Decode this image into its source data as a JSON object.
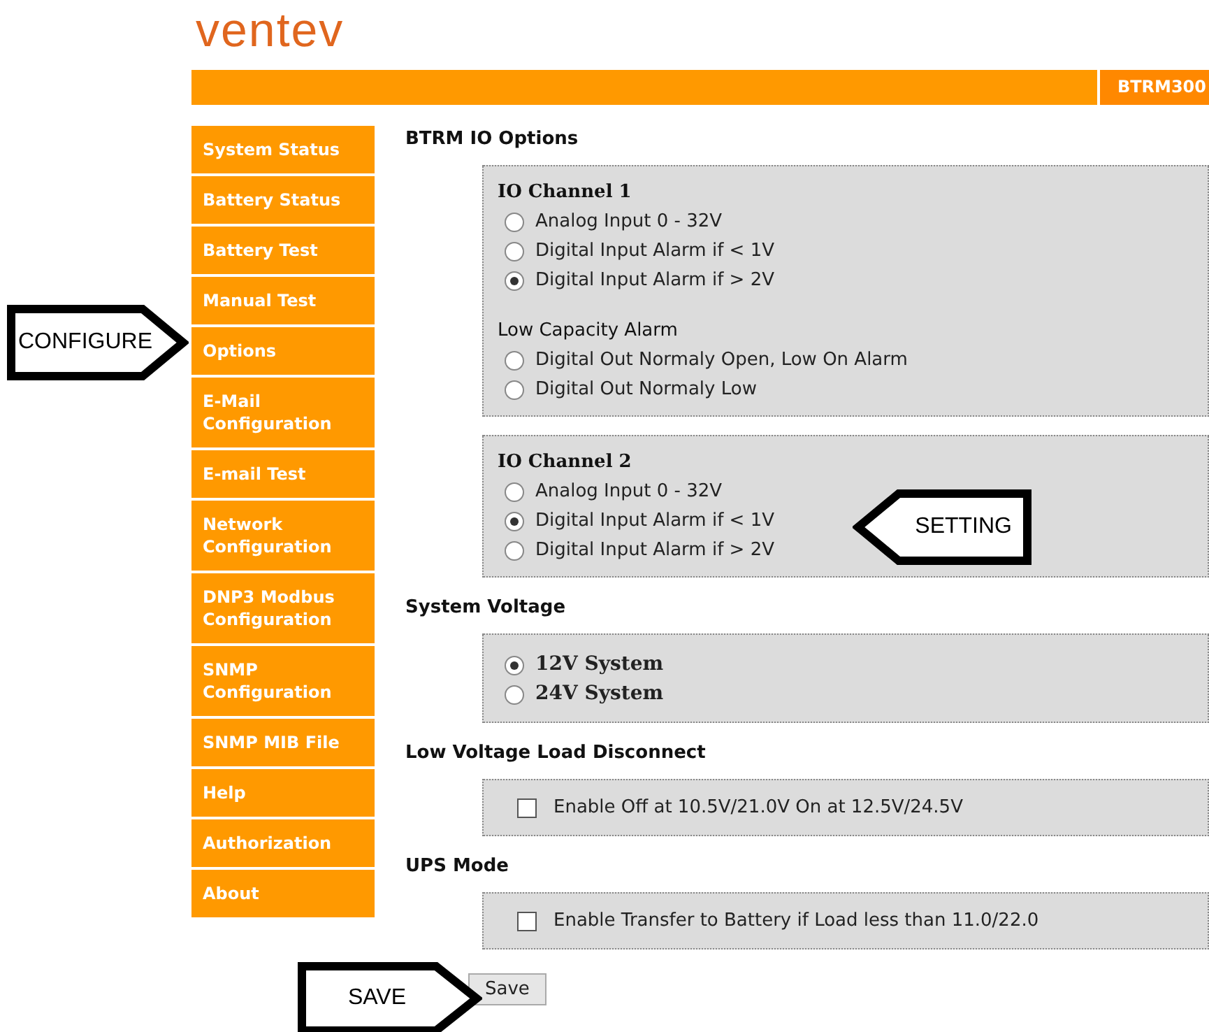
{
  "logo": "ventev",
  "header": {
    "badge": "BTRM300"
  },
  "nav": [
    {
      "label": "System Status"
    },
    {
      "label": "Battery Status"
    },
    {
      "label": "Battery Test"
    },
    {
      "label": "Manual Test"
    },
    {
      "label": "Options"
    },
    {
      "label": "E-Mail Configuration"
    },
    {
      "label": "E-mail Test"
    },
    {
      "label": "Network Configuration"
    },
    {
      "label": "DNP3 Modbus Configuration"
    },
    {
      "label": "SNMP Configuration"
    },
    {
      "label": "SNMP MIB File"
    },
    {
      "label": "Help"
    },
    {
      "label": "Authorization"
    },
    {
      "label": "About"
    }
  ],
  "sections": [
    {
      "heading": "BTRM IO Options",
      "boxes": [
        {
          "groups": [
            {
              "kind": "channel",
              "title": "IO Channel 1",
              "options": [
                {
                  "label": "Analog Input 0 - 32V",
                  "selected": false
                },
                {
                  "label": "Digital Input Alarm if < 1V",
                  "selected": false
                },
                {
                  "label": "Digital Input Alarm if > 2V",
                  "selected": true
                }
              ]
            },
            {
              "kind": "alarm",
              "title": "Low Capacity Alarm",
              "options": [
                {
                  "label": "Digital Out Normaly Open, Low On Alarm",
                  "selected": false
                },
                {
                  "label": "Digital Out Normaly Low",
                  "selected": false
                }
              ]
            }
          ]
        },
        {
          "groups": [
            {
              "kind": "channel",
              "title": "IO Channel 2",
              "options": [
                {
                  "label": "Analog Input 0 - 32V",
                  "selected": false
                },
                {
                  "label": "Digital Input Alarm if < 1V",
                  "selected": true
                },
                {
                  "label": "Digital Input Alarm if > 2V",
                  "selected": false
                }
              ]
            }
          ]
        }
      ]
    },
    {
      "heading": "System Voltage",
      "boxes": [
        {
          "groups": [
            {
              "kind": "voltage",
              "options": [
                {
                  "label": "12V System",
                  "selected": true
                },
                {
                  "label": "24V System",
                  "selected": false
                }
              ]
            }
          ]
        }
      ]
    },
    {
      "heading": "Low Voltage Load Disconnect",
      "boxes": [
        {
          "groups": [
            {
              "kind": "checkbox",
              "options": [
                {
                  "label": "Enable Off at 10.5V/21.0V On at 12.5V/24.5V",
                  "checked": false
                }
              ]
            }
          ]
        }
      ]
    },
    {
      "heading": "UPS Mode",
      "boxes": [
        {
          "groups": [
            {
              "kind": "checkbox",
              "options": [
                {
                  "label": "Enable Transfer to Battery if Load less than 11.0/22.0",
                  "checked": false
                }
              ]
            }
          ]
        }
      ]
    }
  ],
  "save_button": "Save",
  "callouts": [
    {
      "label": "CONFIGURE",
      "kind": "rightward"
    },
    {
      "label": "SETTING",
      "kind": "leftward"
    },
    {
      "label": "SAVE",
      "kind": "rightward"
    }
  ]
}
